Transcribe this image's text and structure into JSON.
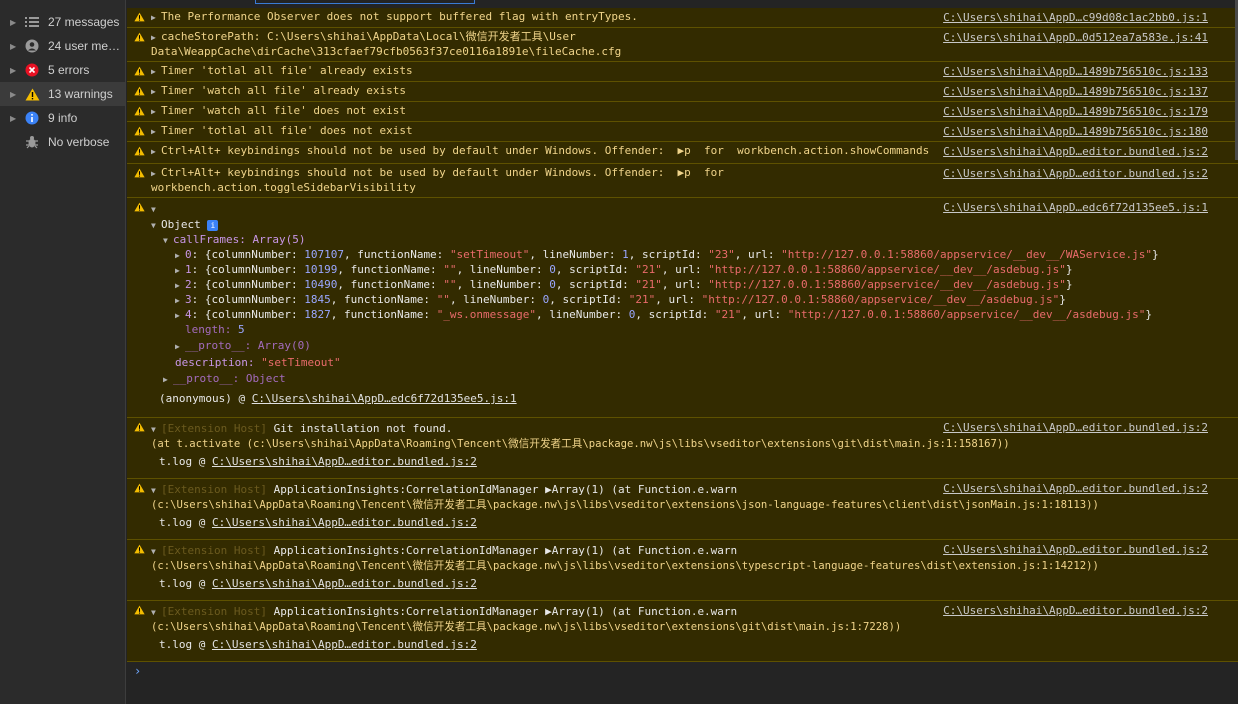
{
  "sidebar": {
    "items": [
      {
        "label": "27 messages",
        "icon": "list-icon"
      },
      {
        "label": "24 user mes...",
        "icon": "user-icon"
      },
      {
        "label": "5 errors",
        "icon": "error-icon"
      },
      {
        "label": "13 warnings",
        "icon": "warning-icon"
      },
      {
        "label": "9 info",
        "icon": "info-icon"
      },
      {
        "label": "No verbose",
        "icon": "bug-icon"
      }
    ]
  },
  "colors": {
    "warning_bg": "#332b00",
    "warning_text": "#ffcc66",
    "link_blue": "#6fa8ff",
    "error_red": "#e81123"
  },
  "messages": [
    {
      "text": "The Performance Observer does not support buffered flag with entryTypes.",
      "src": "C:\\Users\\shihai\\AppD…c99d08c1ac2bb0.js:1"
    },
    {
      "text1": "cacheStorePath: C:\\Users\\shihai\\AppData\\Local\\微信开发者工具\\User",
      "text2": "Data\\WeappCache\\dirCache\\313cfaef79cfb0563f37ce0116a1891e\\fileCache.cfg",
      "src": "C:\\Users\\shihai\\AppD…0d512ea7a583e.js:41"
    },
    {
      "text": "Timer 'totlal all file' already exists",
      "src": "C:\\Users\\shihai\\AppD…1489b756510c.js:133"
    },
    {
      "text": "Timer 'watch all file' already exists",
      "src": "C:\\Users\\shihai\\AppD…1489b756510c.js:137"
    },
    {
      "text": "Timer 'watch all file' does not exist",
      "src": "C:\\Users\\shihai\\AppD…1489b756510c.js:179"
    },
    {
      "text": "Timer 'totlal all file' does not exist",
      "src": "C:\\Users\\shihai\\AppD…1489b756510c.js:180"
    },
    {
      "text": "Ctrl+Alt+ keybindings should not be used by default under Windows. Offender:  ▶p  for  workbench.action.showCommands",
      "src": "C:\\Users\\shihai\\AppD…editor.bundled.js:2"
    },
    {
      "text1": "Ctrl+Alt+ keybindings should not be used by default under Windows. Offender:  ▶p  for",
      "text2": "workbench.action.toggleSidebarVisibility",
      "src": "C:\\Users\\shihai\\AppD…editor.bundled.js:2"
    }
  ],
  "object_msg": {
    "src": "C:\\Users\\shihai\\AppD…edc6f72d135ee5.js:1",
    "object_label": "Object",
    "info_badge": "i",
    "callframes_label": "callFrames: Array(5)",
    "frames": [
      {
        "idx": "0",
        "col": "107107",
        "fn": "\"setTimeout\"",
        "line": "1",
        "sid": "\"23\"",
        "url": "\"http://127.0.0.1:58860/appservice/__dev__/WAService.js\""
      },
      {
        "idx": "1",
        "col": "10199",
        "fn": "\"\"",
        "line": "0",
        "sid": "\"21\"",
        "url": "\"http://127.0.0.1:58860/appservice/__dev__/asdebug.js\""
      },
      {
        "idx": "2",
        "col": "10490",
        "fn": "\"\"",
        "line": "0",
        "sid": "\"21\"",
        "url": "\"http://127.0.0.1:58860/appservice/__dev__/asdebug.js\""
      },
      {
        "idx": "3",
        "col": "1845",
        "fn": "\"\"",
        "line": "0",
        "sid": "\"21\"",
        "url": "\"http://127.0.0.1:58860/appservice/__dev__/asdebug.js\""
      },
      {
        "idx": "4",
        "col": "1827",
        "fn": "\"_ws.onmessage\"",
        "line": "0",
        "sid": "\"21\"",
        "url": "\"http://127.0.0.1:58860/appservice/__dev__/asdebug.js\""
      }
    ],
    "length_label": "length:",
    "length_value": "5",
    "proto_array": "__proto__: Array(0)",
    "description_label": "description:",
    "description_value": "\"setTimeout\"",
    "proto_object": "__proto__: Object",
    "anon_prefix": "(anonymous) @",
    "anon_link": "C:\\Users\\shihai\\AppD…edc6f72d135ee5.js:1"
  },
  "ext_msgs": [
    {
      "tag": "[Extension Host]",
      "text": "Git installation not found.",
      "line2": "(at t.activate (c:\\Users\\shihai\\AppData\\Roaming\\Tencent\\微信开发者工具\\package.nw\\js\\libs\\vseditor\\extensions\\git\\dist\\main.js:1:158167))",
      "trace_prefix": "t.log @",
      "trace_link": "C:\\Users\\shihai\\AppD…editor.bundled.js:2",
      "src": "C:\\Users\\shihai\\AppD…editor.bundled.js:2"
    },
    {
      "tag": "[Extension Host]",
      "text": "ApplicationInsights:CorrelationIdManager ▶Array(1) (at Function.e.warn",
      "line2": "(c:\\Users\\shihai\\AppData\\Roaming\\Tencent\\微信开发者工具\\package.nw\\js\\libs\\vseditor\\extensions\\json-language-features\\client\\dist\\jsonMain.js:1:18113))",
      "trace_prefix": "t.log @",
      "trace_link": "C:\\Users\\shihai\\AppD…editor.bundled.js:2",
      "src": "C:\\Users\\shihai\\AppD…editor.bundled.js:2"
    },
    {
      "tag": "[Extension Host]",
      "text": "ApplicationInsights:CorrelationIdManager ▶Array(1) (at Function.e.warn",
      "line2": "(c:\\Users\\shihai\\AppData\\Roaming\\Tencent\\微信开发者工具\\package.nw\\js\\libs\\vseditor\\extensions\\typescript-language-features\\dist\\extension.js:1:14212))",
      "trace_prefix": "t.log @",
      "trace_link": "C:\\Users\\shihai\\AppD…editor.bundled.js:2",
      "src": "C:\\Users\\shihai\\AppD…editor.bundled.js:2"
    },
    {
      "tag": "[Extension Host]",
      "text": "ApplicationInsights:CorrelationIdManager ▶Array(1) (at Function.e.warn",
      "line2": "(c:\\Users\\shihai\\AppData\\Roaming\\Tencent\\微信开发者工具\\package.nw\\js\\libs\\vseditor\\extensions\\git\\dist\\main.js:1:7228))",
      "trace_prefix": "t.log @",
      "trace_link": "C:\\Users\\shihai\\AppD…editor.bundled.js:2",
      "src": "C:\\Users\\shihai\\AppD…editor.bundled.js:2"
    }
  ],
  "prompt": "›"
}
